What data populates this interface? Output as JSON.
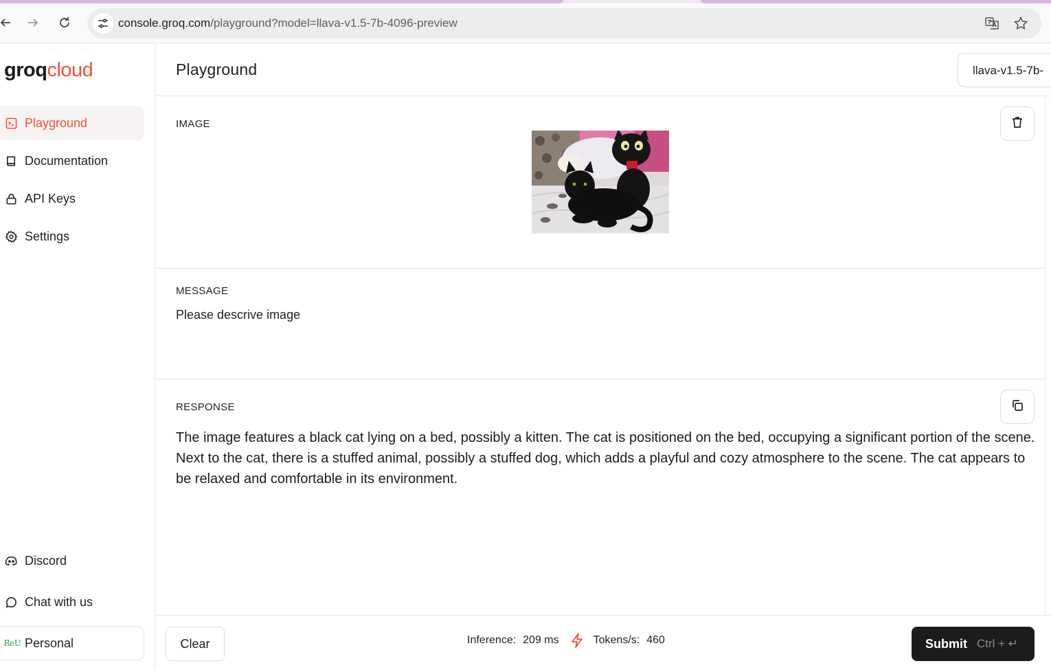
{
  "browser": {
    "url_host": "console.groq.com",
    "url_path": "/playground?model=llava-v1.5-7b-4096-preview"
  },
  "sidebar": {
    "logo_groq": "groq",
    "logo_cloud": "cloud",
    "items": [
      {
        "label": "Playground",
        "icon": "playground-icon",
        "active": true
      },
      {
        "label": "Documentation",
        "icon": "book-icon"
      },
      {
        "label": "API Keys",
        "icon": "lock-icon"
      },
      {
        "label": "Settings",
        "icon": "gear-icon"
      }
    ],
    "bottom_items": [
      {
        "label": "Discord",
        "icon": "discord-icon"
      },
      {
        "label": "Chat with us",
        "icon": "chat-bubble-icon"
      },
      {
        "label": "Personal",
        "icon": "org-avatar-icon",
        "avatar_text": "ReU"
      }
    ]
  },
  "header": {
    "title": "Playground",
    "model_select": "llava-v1.5-7b-"
  },
  "sections": {
    "image_label": "IMAGE",
    "message_label": "MESSAGE",
    "message_text": "Please descrive image",
    "response_label": "RESPONSE",
    "response_text": "The image features a black cat lying on a bed, possibly a kitten. The cat is positioned on the bed, occupying a significant portion of the scene. Next to the cat, there is a stuffed animal, possibly a stuffed dog, which adds a playful and cozy atmosphere to the scene. The cat appears to be relaxed and comfortable in its environment."
  },
  "footer": {
    "clear_label": "Clear",
    "inference_label": "Inference:",
    "inference_value": "209 ms",
    "tokens_label": "Tokens/s:",
    "tokens_value": "460",
    "submit_label": "Submit",
    "submit_hint": "Ctrl + ↵"
  },
  "colors": {
    "accent": "#f55036",
    "submit_bg": "#1c1c1c",
    "active_nav_bg": "#f6f3f2"
  }
}
